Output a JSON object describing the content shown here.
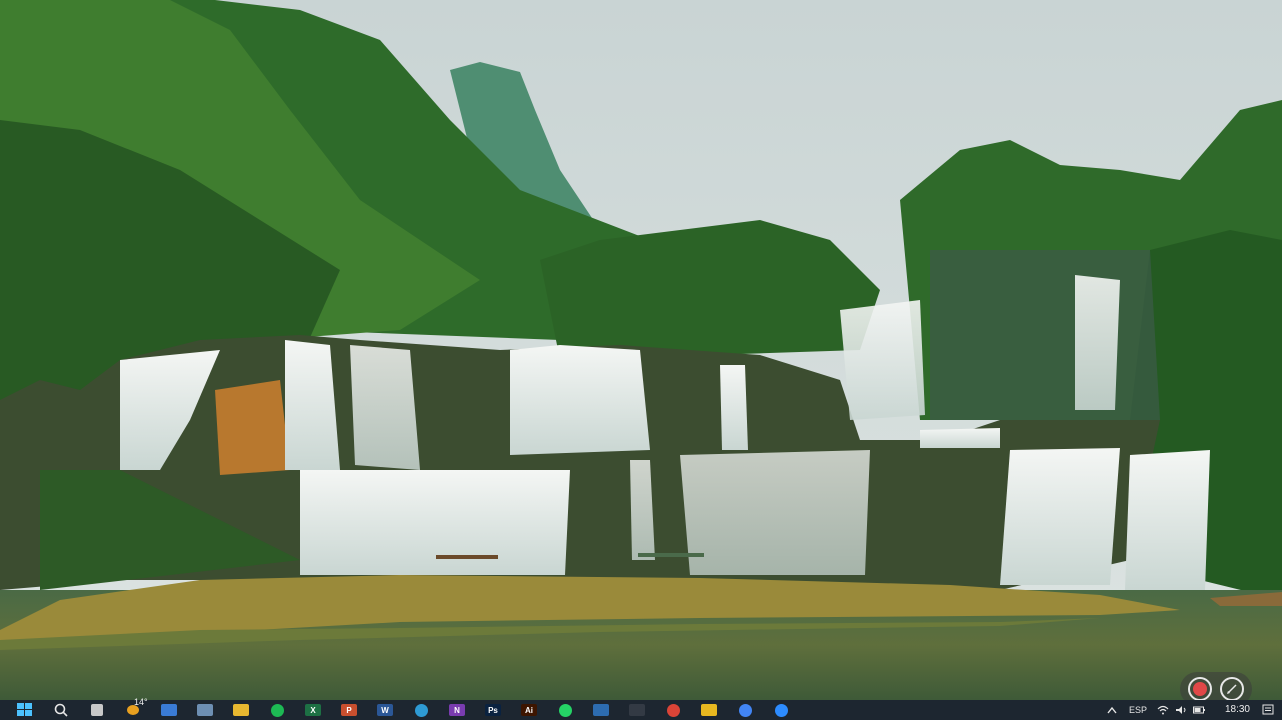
{
  "desktop": {
    "wallpaper": "waterfall-landscape"
  },
  "recorder": {
    "record_icon": "record-icon",
    "pen_icon": "pen-icon",
    "accent": "#e04848"
  },
  "taskbar": {
    "weather_temp": "14°",
    "apps": [
      {
        "name": "file-icon",
        "color": "#c8c8c8",
        "label": ""
      },
      {
        "name": "weather-icon",
        "color": "#e8a020",
        "label": ""
      },
      {
        "name": "store-icon",
        "color": "#3a7bd5",
        "label": ""
      },
      {
        "name": "calculator-icon",
        "color": "#6d8fb3",
        "label": ""
      },
      {
        "name": "folder-icon",
        "color": "#e8b830",
        "label": ""
      },
      {
        "name": "spotify-icon",
        "color": "#1db954",
        "label": ""
      },
      {
        "name": "excel-icon",
        "color": "#1d7044",
        "label": "X"
      },
      {
        "name": "powerpoint-icon",
        "color": "#c84f2e",
        "label": "P"
      },
      {
        "name": "word-icon",
        "color": "#2b5797",
        "label": "W"
      },
      {
        "name": "edge-icon",
        "color": "#2e9bd5",
        "label": ""
      },
      {
        "name": "onenote-icon",
        "color": "#7a3cb0",
        "label": "N"
      },
      {
        "name": "photoshop-icon",
        "color": "#0a2240",
        "label": "Ps"
      },
      {
        "name": "illustrator-icon",
        "color": "#3d1500",
        "label": "Ai"
      },
      {
        "name": "whatsapp-icon",
        "color": "#25d366",
        "label": ""
      },
      {
        "name": "app-blue-icon",
        "color": "#2d6cb0",
        "label": ""
      },
      {
        "name": "app-dark-icon",
        "color": "#333a44",
        "label": ""
      },
      {
        "name": "chrome-icon",
        "color": "#db4437",
        "label": ""
      },
      {
        "name": "app-yellow-icon",
        "color": "#e8b820",
        "label": ""
      },
      {
        "name": "chrome-profile-icon",
        "color": "#4285f4",
        "label": ""
      },
      {
        "name": "zoom-icon",
        "color": "#2d8cff",
        "label": ""
      }
    ],
    "tray": {
      "lang": "ESP",
      "time": "18:30"
    }
  }
}
